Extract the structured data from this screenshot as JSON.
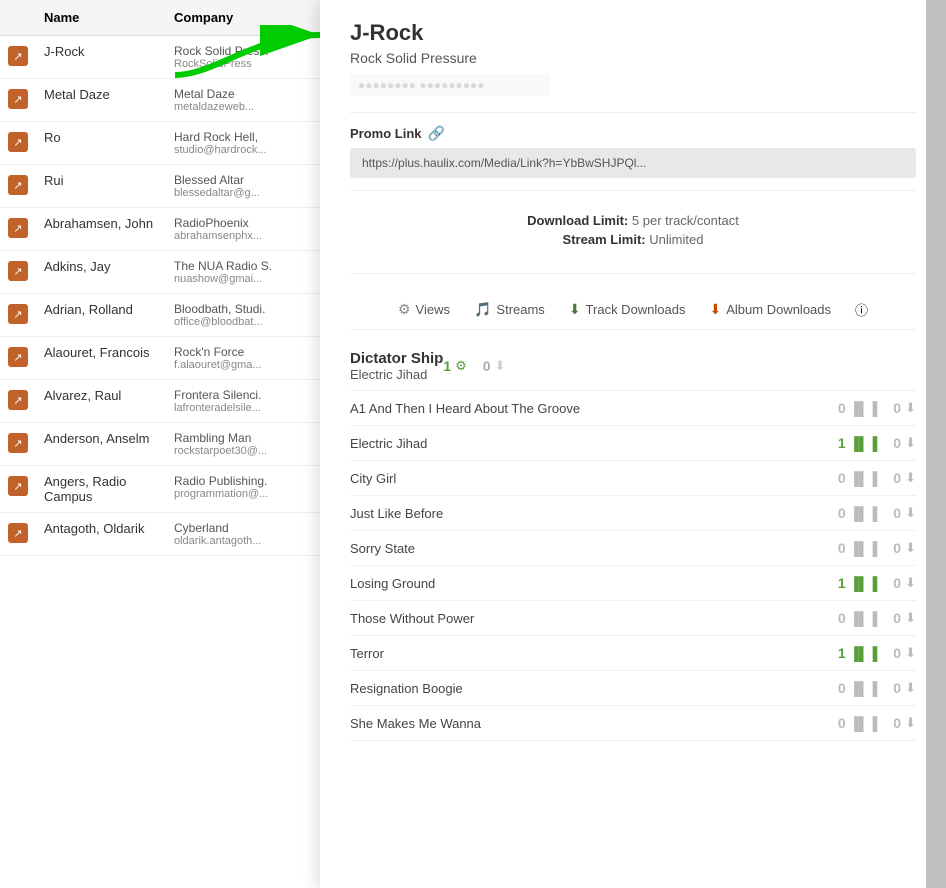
{
  "table": {
    "headers": [
      "",
      "Name",
      "Company"
    ],
    "rows": [
      {
        "name": "J-Rock",
        "company": "Rock Solid Press.",
        "email": "RockSolidPress"
      },
      {
        "name": "Metal Daze",
        "company": "Metal Daze",
        "email": "metaldazeweb..."
      },
      {
        "name": "Ro",
        "company": "Hard Rock Hell,",
        "email": "studio@hardrock..."
      },
      {
        "name": "Rui",
        "company": "Blessed Altar",
        "email": "blessedaltar@g..."
      },
      {
        "name": "Abrahamsen, John",
        "company": "RadioPhoenix",
        "email": "abrahamsenphx..."
      },
      {
        "name": "Adkins, Jay",
        "company": "The NUA Radio S.",
        "email": "nuashow@gmai..."
      },
      {
        "name": "Adrian, Rolland",
        "company": "Bloodbath, Studi.",
        "email": "office@bloodbat..."
      },
      {
        "name": "Alaouret, Francois",
        "company": "Rock'n Force",
        "email": "f.alaouret@gma..."
      },
      {
        "name": "Alvarez, Raul",
        "company": "Frontera Silenci.",
        "email": "lafronteradelsile..."
      },
      {
        "name": "Anderson, Anselm",
        "company": "Rambling Man",
        "email": "rockstarpoet30@..."
      },
      {
        "name": "Angers, Radio Campus",
        "company": "Radio Publishing.",
        "email": "programmation@..."
      },
      {
        "name": "Antagoth, Oldarik",
        "company": "Cyberland",
        "email": "oldarik.antagoth..."
      }
    ]
  },
  "detail": {
    "title": "J-Rock",
    "subtitle": "Rock Solid Pressure",
    "contact_placeholder": "contact info hidden",
    "promo_link_label": "Promo Link",
    "promo_link_url": "https://plus.haulix.com/Media/Link?h=YbBwSHJPQl...",
    "download_limit_label": "Download Limit:",
    "download_limit_value": "5 per track/contact",
    "stream_limit_label": "Stream Limit:",
    "stream_limit_value": "Unlimited",
    "tabs": {
      "views": "Views",
      "streams": "Streams",
      "track_downloads": "Track Downloads",
      "album_downloads": "Album Downloads"
    },
    "album": {
      "name": "Dictator Ship",
      "subtitle": "Electric Jihad",
      "streams": "1",
      "downloads": "0",
      "tracks": [
        {
          "name": "A1 And Then I Heard About The Groove",
          "streams": "0",
          "downloads": "0"
        },
        {
          "name": "Electric Jihad",
          "streams": "1",
          "downloads": "0",
          "stream_active": true
        },
        {
          "name": "City Girl",
          "streams": "0",
          "downloads": "0"
        },
        {
          "name": "Just Like Before",
          "streams": "0",
          "downloads": "0"
        },
        {
          "name": "Sorry State",
          "streams": "0",
          "downloads": "0"
        },
        {
          "name": "Losing Ground",
          "streams": "1",
          "downloads": "0",
          "stream_active": true
        },
        {
          "name": "Those Without Power",
          "streams": "0",
          "downloads": "0"
        },
        {
          "name": "Terror",
          "streams": "1",
          "downloads": "0",
          "stream_active": true
        },
        {
          "name": "Resignation Boogie",
          "streams": "0",
          "downloads": "0"
        },
        {
          "name": "She Makes Me Wanna",
          "streams": "0",
          "downloads": "0"
        }
      ]
    }
  }
}
